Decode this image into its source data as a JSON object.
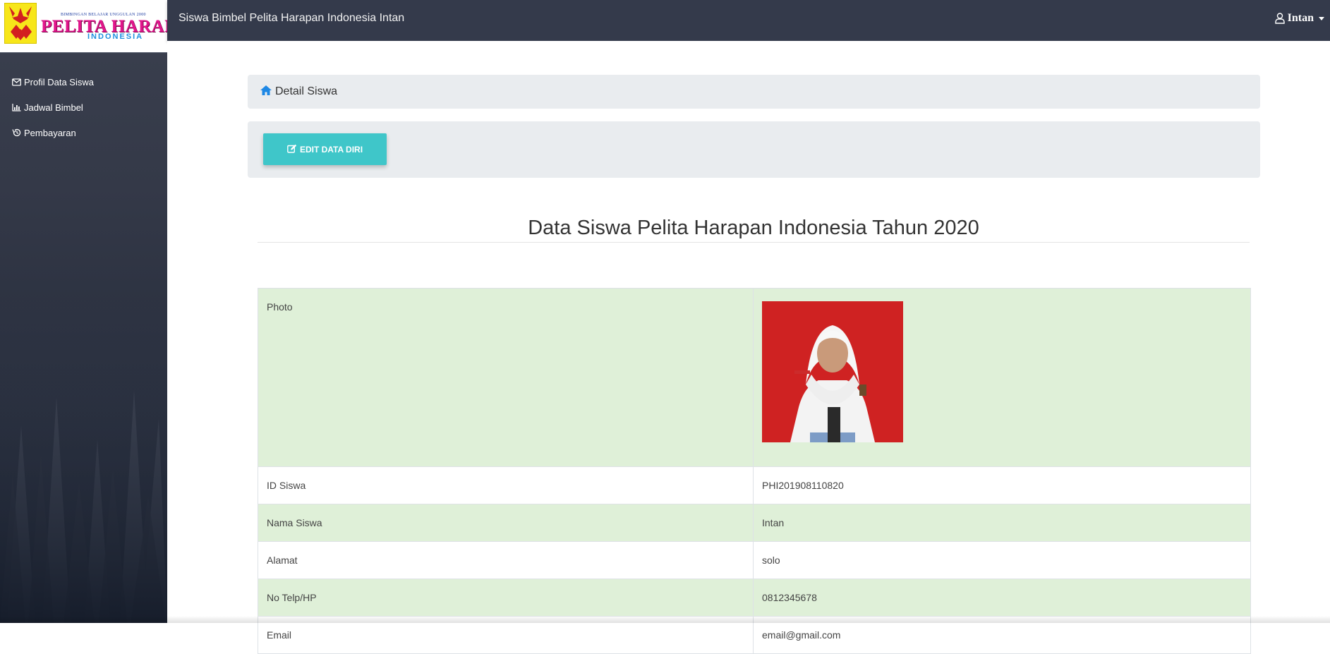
{
  "app": {
    "title": "Siswa Bimbel Pelita Harapan Indonesia Intan",
    "user_name": "Intan"
  },
  "logo": {
    "tagline": "BIMBINGAN BELAJAR UNGGULAN 2000",
    "brand": "PELITA HARAPAN",
    "brand_sub": "INDONESIA"
  },
  "sidebar": {
    "items": [
      {
        "label": "Profil Data Siswa",
        "icon": "envelope-icon"
      },
      {
        "label": "Jadwal Bimbel",
        "icon": "bar-chart-icon"
      },
      {
        "label": "Pembayaran",
        "icon": "history-icon"
      }
    ]
  },
  "breadcrumb": {
    "label": "Detail Siswa",
    "icon": "home-icon"
  },
  "actions": {
    "edit_label": "EDIT DATA DIRI",
    "edit_icon": "edit-icon"
  },
  "main": {
    "heading": "Data Siswa Pelita Harapan Indonesia Tahun 2020"
  },
  "student": {
    "photo_label": "Photo",
    "rows": [
      {
        "label": "ID Siswa",
        "value": "PHI201908110820"
      },
      {
        "label": "Nama Siswa",
        "value": "Intan"
      },
      {
        "label": "Alamat",
        "value": "solo"
      },
      {
        "label": "No Telp/HP",
        "value": "0812345678"
      },
      {
        "label": "Email",
        "value": "email@gmail.com"
      }
    ]
  },
  "colors": {
    "topbar": "#343a4b",
    "accent_button": "#3fc6c9",
    "row_green": "#dff0d8",
    "breadcrumb_bg": "#e9ecef",
    "home_icon": "#1e88e5"
  }
}
